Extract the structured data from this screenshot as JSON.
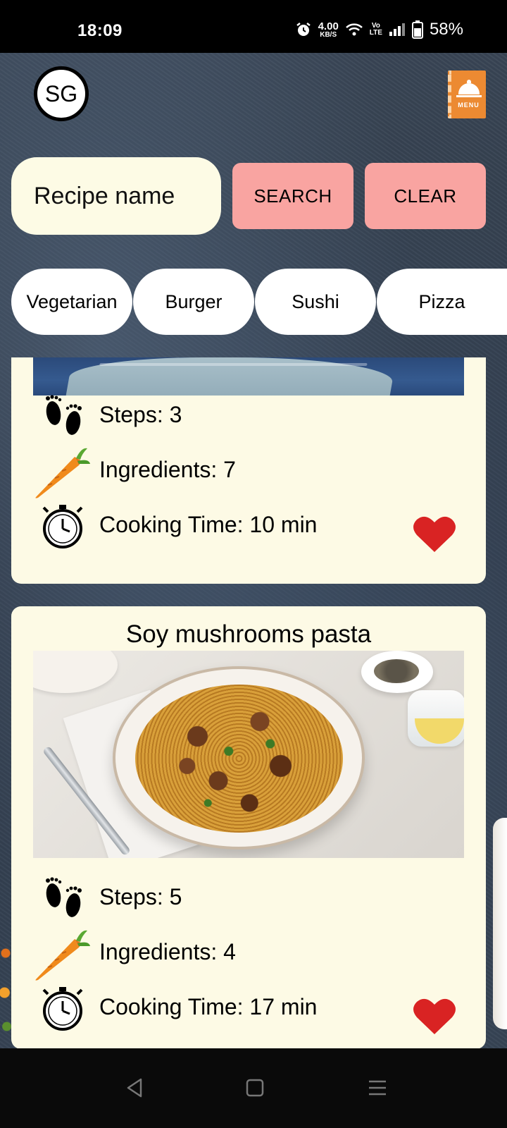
{
  "status_bar": {
    "time": "18:09",
    "net_speed_value": "4.00",
    "net_speed_unit": "KB/S",
    "volte_top": "Vo",
    "volte_bottom": "LTE",
    "battery": "58%"
  },
  "header": {
    "avatar_initials": "SG",
    "menu_icon_text": "MENU"
  },
  "search": {
    "placeholder": "Recipe name",
    "search_label": "SEARCH",
    "clear_label": "CLEAR"
  },
  "categories": [
    "Vegetarian",
    "Burger",
    "Sushi",
    "Pizza"
  ],
  "recipes": [
    {
      "title": "",
      "steps": "Steps: 3",
      "ingredients": "Ingredients: 7",
      "cooking_time": "Cooking Time: 10 min",
      "favorite": true
    },
    {
      "title": "Soy mushrooms pasta",
      "steps": "Steps: 5",
      "ingredients": "Ingredients: 4",
      "cooking_time": "Cooking Time: 17 min",
      "favorite": true
    }
  ],
  "colors": {
    "button_bg": "#f9a4a1",
    "card_bg": "#fdfae5",
    "input_bg": "#fdfbe5",
    "heart": "#d92323",
    "carrot": "#f08a1c"
  }
}
